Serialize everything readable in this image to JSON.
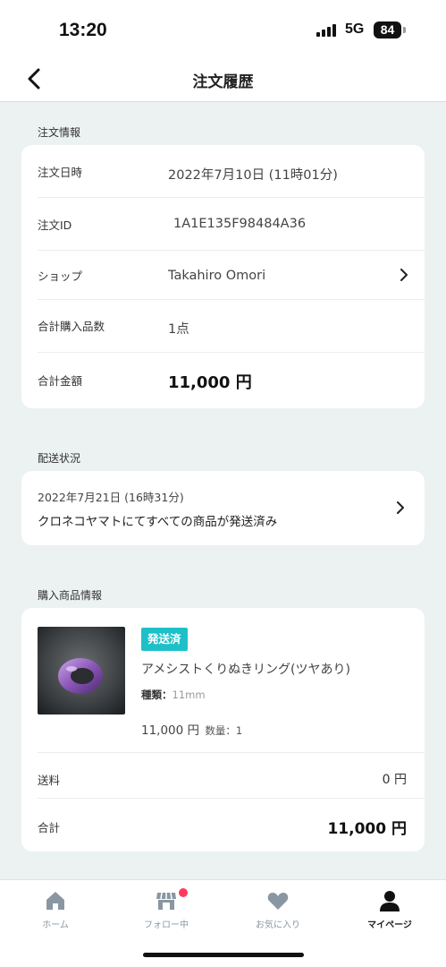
{
  "status_bar": {
    "time": "13:20",
    "network": "5G",
    "battery": "84"
  },
  "nav": {
    "title": "注文履歴"
  },
  "order_info": {
    "section_label": "注文情報",
    "rows": [
      {
        "label": "注文日時",
        "value": "2022年7月10日 (11時01分)"
      },
      {
        "label": "注文ID",
        "value": "1A1E135F98484A36"
      },
      {
        "label": "ショップ",
        "value": "Takahiro Omori"
      },
      {
        "label": "合計購入品数",
        "value": "1点"
      },
      {
        "label": "合計金額",
        "value": "11,000 円"
      }
    ]
  },
  "shipping": {
    "section_label": "配送状況",
    "date": "2022年7月21日 (16時31分)",
    "status": "クロネコヤマトにてすべての商品が発送済み"
  },
  "purchase": {
    "section_label": "購入商品情報",
    "badge": "発送済",
    "product_name": "アメシストくりぬきリング(ツヤあり)",
    "variant_label": "種類：",
    "variant_value": "11mm",
    "price": "11,000 円",
    "quantity_label": "数量：1",
    "shipping_fee_label": "送料",
    "shipping_fee_value": "0 円",
    "total_label": "合計",
    "total_value": "11,000 円"
  },
  "tabs": [
    {
      "label": "ホーム",
      "icon": "home-icon"
    },
    {
      "label": "フォロー中",
      "icon": "shop-icon"
    },
    {
      "label": "お気に入り",
      "icon": "heart-icon"
    },
    {
      "label": "マイページ",
      "icon": "person-icon"
    }
  ],
  "colors": {
    "accent": "#1ec0c8",
    "badge_dot": "#ff3b5c",
    "background": "#ecf1f1"
  }
}
